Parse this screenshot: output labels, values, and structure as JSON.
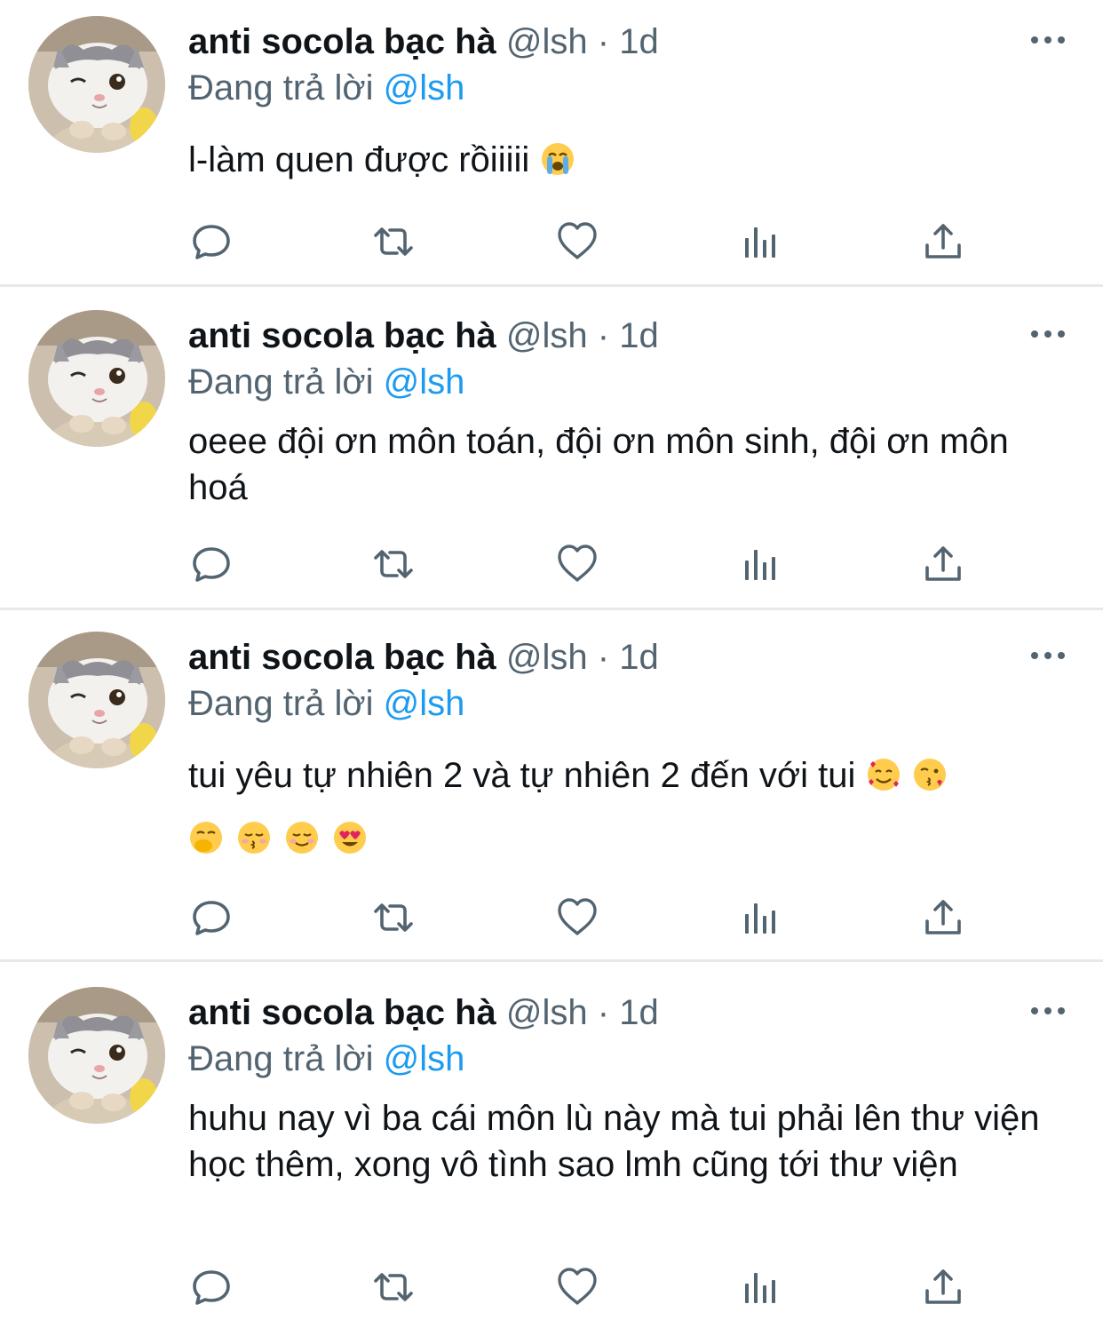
{
  "tweets": [
    {
      "name": "anti socola bạc hà",
      "handle": "@lsh",
      "dot": "·",
      "time": "1d",
      "reply_prefix": "Đang trả lời",
      "reply_to": "@lsh",
      "text": "l-làm quen được rồiiiii",
      "emoji": [
        "loudly-crying-face-emoji"
      ]
    },
    {
      "name": "anti socola bạc hà",
      "handle": "@lsh",
      "dot": "·",
      "time": "1d",
      "reply_prefix": "Đang trả lời",
      "reply_to": "@lsh",
      "text": "oeee đội ơn môn toán, đội ơn môn sinh, đội ơn môn hoá",
      "emoji": []
    },
    {
      "name": "anti socola bạc hà",
      "handle": "@lsh",
      "dot": "·",
      "time": "1d",
      "reply_prefix": "Đang trả lời",
      "reply_to": "@lsh",
      "text": "tui yêu tự nhiên 2 và tự nhiên 2 đến với tui",
      "emoji": [
        "smiling-face-with-hearts-emoji",
        "face-blowing-kiss-emoji",
        "face-with-hand-over-mouth-emoji",
        "kissing-face-closed-eyes-emoji",
        "smiling-face-emoji",
        "heart-eyes-emoji"
      ]
    },
    {
      "name": "anti socola bạc hà",
      "handle": "@lsh",
      "dot": "·",
      "time": "1d",
      "reply_prefix": "Đang trả lời",
      "reply_to": "@lsh",
      "text": "huhu nay vì ba cái môn lù này mà tui phải lên thư viện học thêm, xong vô tình sao lmh cũng tới thư viện",
      "emoji": []
    }
  ],
  "icons": {
    "more": "more-horizontal-icon",
    "reply": "reply-icon",
    "retweet": "retweet-icon",
    "like": "heart-icon",
    "views": "views-icon",
    "share": "share-icon"
  },
  "colors": {
    "text": "#0f1419",
    "secondary": "#536471",
    "accent": "#1d9bf0",
    "divider": "#e6e9eb"
  }
}
